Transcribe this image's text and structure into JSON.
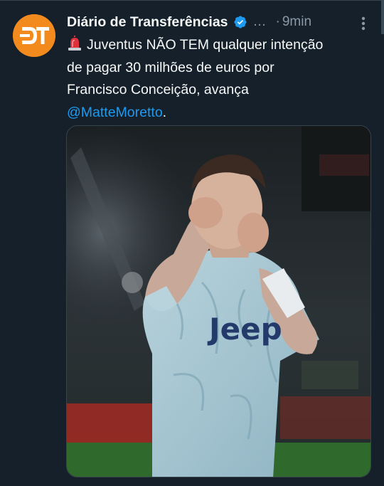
{
  "tweet": {
    "display_name": "Diário de Transferências",
    "verified_icon": "verified-badge-icon",
    "truncation": "…",
    "separator": "·",
    "timestamp": "9min",
    "more_icon": "more-vertical-icon",
    "avatar_icon": "diario-transferencias-logo",
    "siren_icon": "police-light-emoji",
    "text_line_1": "Juventus NÃO TEM qualquer intenção",
    "text_line_2": "de pagar 30 milhões de euros por",
    "text_line_3": "Francisco Conceição, avança",
    "mention": "@MatteMoretto",
    "text_end": ".",
    "media_jersey_text": "Jeep",
    "colors": {
      "background": "#15202b",
      "text": "#f7f9f9",
      "secondary_text": "#8b98a5",
      "link": "#1d9bf0",
      "avatar": "#f28a1e",
      "verified": "#1d9bf0"
    }
  }
}
